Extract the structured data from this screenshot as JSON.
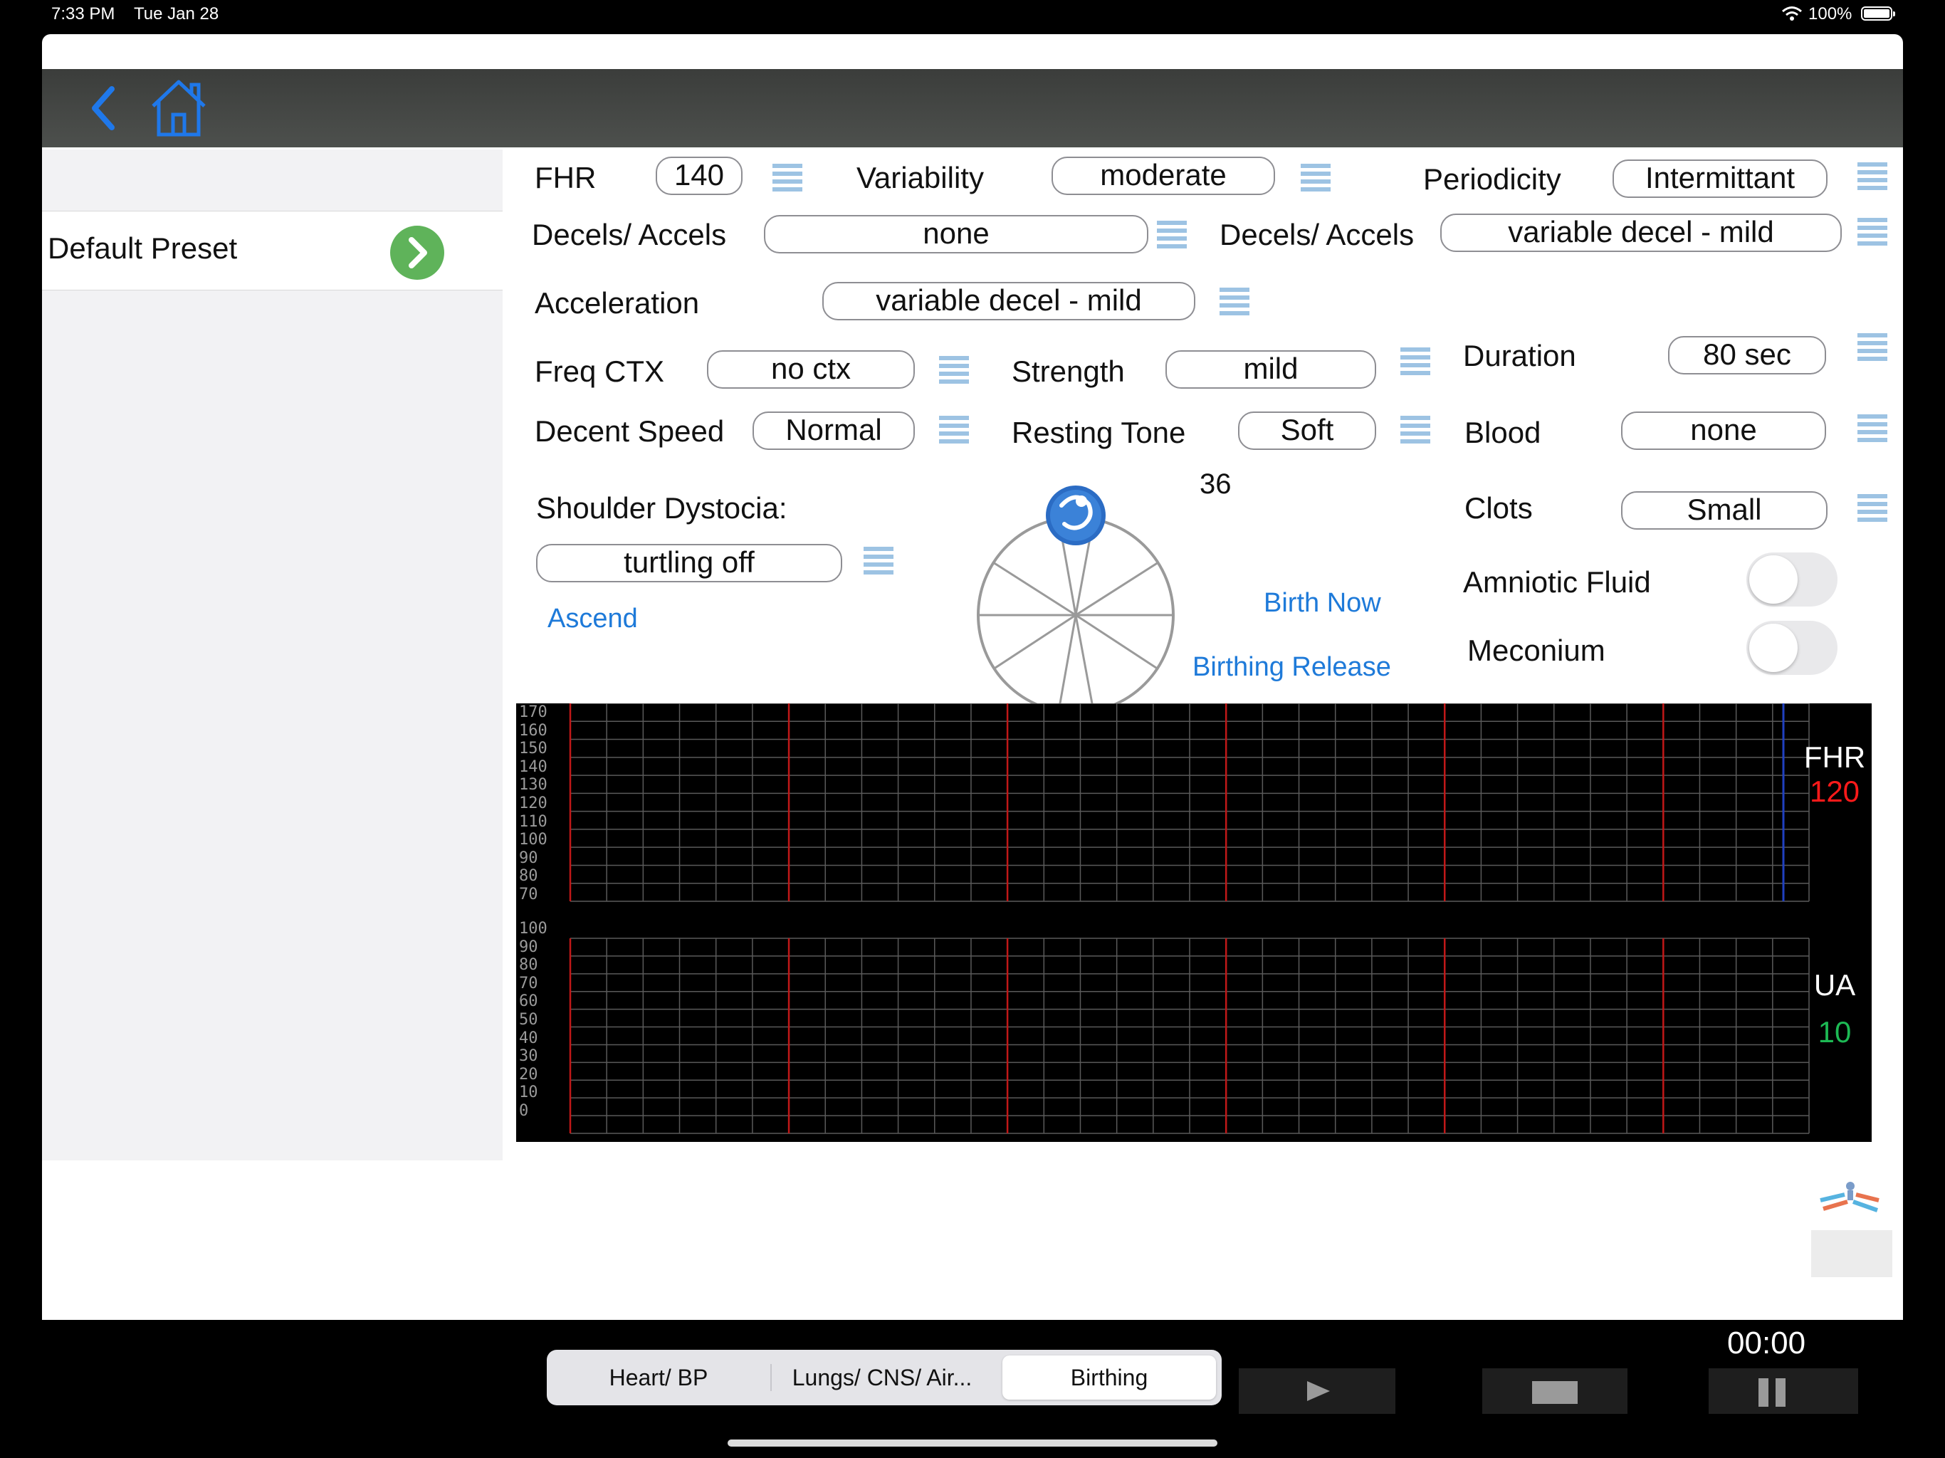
{
  "status_bar": {
    "time": "7:33 PM",
    "date": "Tue Jan 28",
    "battery": "100%"
  },
  "sidebar": {
    "preset_label": "Default Preset"
  },
  "controls": {
    "fhr_label": "FHR",
    "fhr_value": "140",
    "variability_label": "Variability",
    "variability_value": "moderate",
    "periodicity_label": "Periodicity",
    "periodicity_value": "Intermittant",
    "decels1_label": "Decels/ Accels",
    "decels1_value": "none",
    "decels2_label": "Decels/ Accels",
    "decels2_value": "variable decel - mild",
    "acceleration_label": "Acceleration",
    "acceleration_value": "variable decel - mild",
    "freq_ctx_label": "Freq CTX",
    "freq_ctx_value": "no ctx",
    "strength_label": "Strength",
    "strength_value": "mild",
    "duration_label": "Duration",
    "duration_value": "80 sec",
    "decent_speed_label": "Decent Speed",
    "decent_speed_value": "Normal",
    "resting_tone_label": "Resting Tone",
    "resting_tone_value": "Soft",
    "blood_label": "Blood",
    "blood_value": "none",
    "shoulder_label": "Shoulder Dystocia:",
    "shoulder_value": "turtling off",
    "ascend_link": "Ascend",
    "dial_value": "36",
    "clots_label": "Clots",
    "clots_value": "Small",
    "birth_now_link": "Birth Now",
    "birthing_release_link": "Birthing Release",
    "amniotic_label": "Amniotic Fluid",
    "amniotic_on": false,
    "meconium_label": "Meconium",
    "meconium_on": false
  },
  "monitor": {
    "fhr_title": "FHR",
    "fhr_value": "120",
    "ua_title": "UA",
    "ua_value": "10",
    "fhr_ticks": [
      "170",
      "160",
      "150",
      "140",
      "130",
      "120",
      "110",
      "100",
      "90",
      "80",
      "70"
    ],
    "ua_ticks": [
      "100",
      "90",
      "80",
      "70",
      "60",
      "50",
      "40",
      "30",
      "20",
      "10",
      "0"
    ],
    "colors": {
      "fhr_value": "#ff1a1a",
      "ua_value": "#1db954",
      "grid": "#5a5a5a",
      "minute_line": "#c01818"
    }
  },
  "tabs": [
    "Heart/ BP",
    "Lungs/ CNS/ Air...",
    "Birthing"
  ],
  "selected_tab": "Birthing",
  "timer": "00:00"
}
